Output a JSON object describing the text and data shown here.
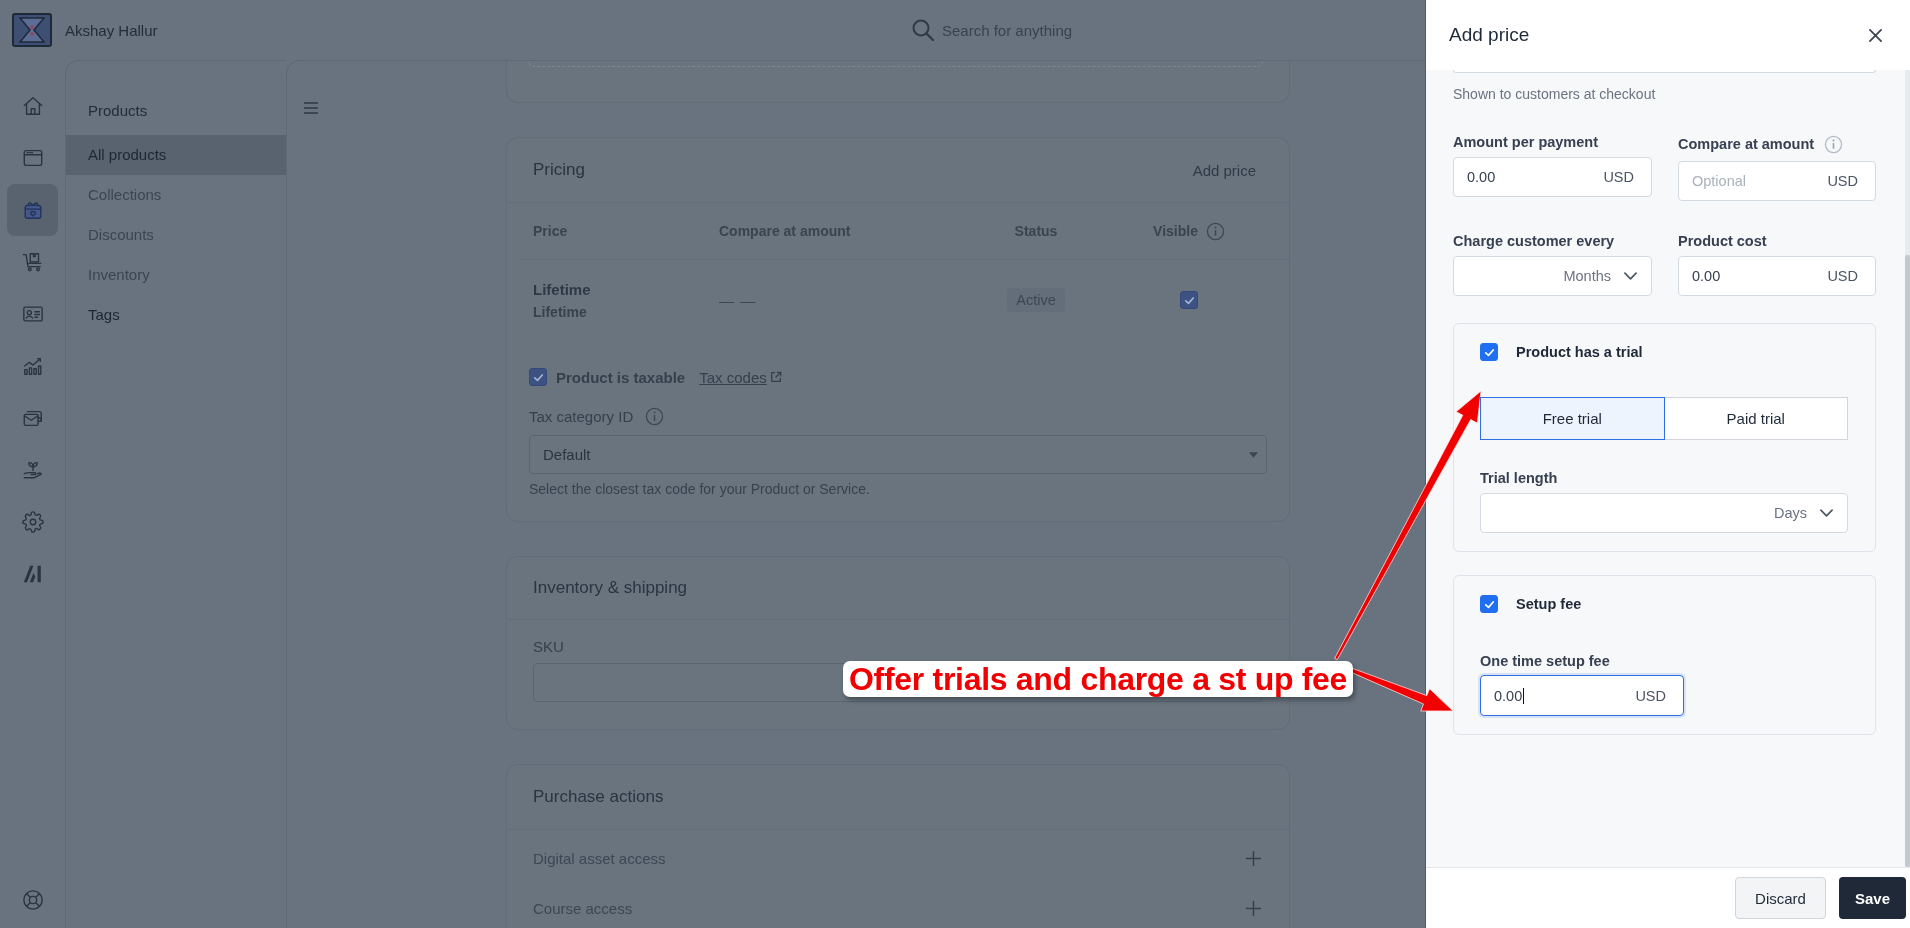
{
  "header": {
    "user_name": "Akshay Hallur",
    "search_placeholder": "Search for anything"
  },
  "rail": [
    {
      "selected": false
    },
    {
      "selected": false
    },
    {
      "selected": true
    },
    {
      "selected": false
    },
    {
      "selected": false
    },
    {
      "selected": false
    },
    {
      "selected": false
    },
    {
      "selected": false
    },
    {
      "selected": false
    },
    {
      "selected": false
    }
  ],
  "nav": {
    "title": "Products",
    "items": [
      {
        "label": "All products",
        "selected": true,
        "disabled": false
      },
      {
        "label": "Collections",
        "selected": false,
        "disabled": true
      },
      {
        "label": "Discounts",
        "selected": false,
        "disabled": true
      },
      {
        "label": "Inventory",
        "selected": false,
        "disabled": true
      },
      {
        "label": "Tags",
        "selected": false,
        "disabled": false
      }
    ]
  },
  "pricing": {
    "title": "Pricing",
    "action": "Add price",
    "columns": [
      "Price",
      "Compare at amount",
      "Status",
      "Visible"
    ],
    "rows": [
      {
        "name": "Lifetime",
        "subtitle": "Lifetime",
        "compare": "— —",
        "status": "Active",
        "visible": true
      }
    ],
    "taxable": {
      "label": "Product is taxable",
      "checked": true,
      "link": "Tax codes"
    },
    "tax_category": {
      "label": "Tax category ID",
      "value": "Default",
      "hint": "Select the closest tax code for your Product or Service."
    }
  },
  "inventory": {
    "title": "Inventory & shipping",
    "sku_label": "SKU"
  },
  "purchase_actions": {
    "title": "Purchase actions",
    "items": [
      "Digital asset access",
      "Course access"
    ]
  },
  "drawer": {
    "title": "Add price",
    "name_hint": "Shown to customers at checkout",
    "amount": {
      "label": "Amount per payment",
      "value": "0.00",
      "currency": "USD"
    },
    "compare": {
      "label": "Compare at amount",
      "placeholder": "Optional",
      "currency": "USD"
    },
    "interval": {
      "label": "Charge customer every",
      "value": "Months"
    },
    "cost": {
      "label": "Product cost",
      "value": "0.00",
      "currency": "USD"
    },
    "trial": {
      "label": "Product has a trial",
      "checked": true,
      "options": [
        {
          "label": "Free trial",
          "selected": true
        },
        {
          "label": "Paid trial",
          "selected": false
        }
      ],
      "length_label": "Trial length",
      "length_unit": "Days"
    },
    "setup_fee": {
      "label": "Setup fee",
      "checked": true,
      "fee_label": "One time setup fee",
      "value": "0.00",
      "currency": "USD",
      "focused": true
    },
    "buttons": [
      {
        "label": "Discard",
        "kind": "secondary"
      },
      {
        "label": "Save",
        "kind": "primary"
      }
    ]
  },
  "annotation": {
    "text": "Offer trials and charge a st up fee"
  }
}
